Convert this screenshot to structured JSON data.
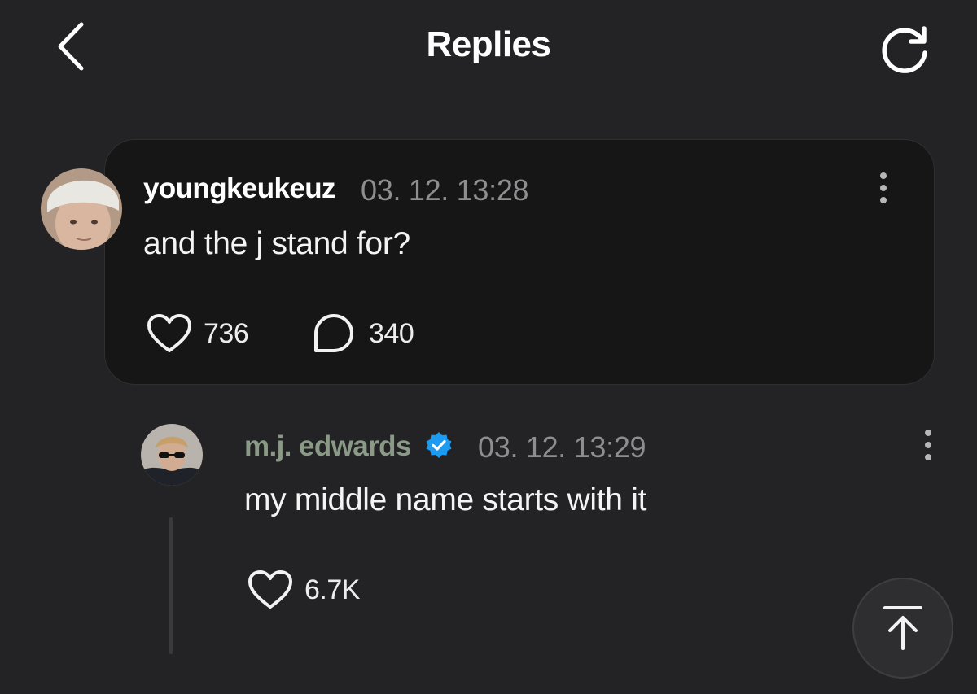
{
  "header": {
    "title": "Replies",
    "back_icon": "chevron-left-icon",
    "refresh_icon": "refresh-icon"
  },
  "parent_comment": {
    "username": "youngkeukeuz",
    "timestamp": "03. 12. 13:28",
    "text": "and the j stand for?",
    "likes": "736",
    "replies": "340"
  },
  "reply": {
    "username": "m.j. edwards",
    "verified": true,
    "timestamp": "03. 12. 13:29",
    "text": "my middle name starts with it",
    "likes": "6.7K"
  },
  "colors": {
    "background": "#232325",
    "card": "#161617",
    "reply_username": "#8a9a86",
    "verified_badge": "#1d9bf0"
  }
}
